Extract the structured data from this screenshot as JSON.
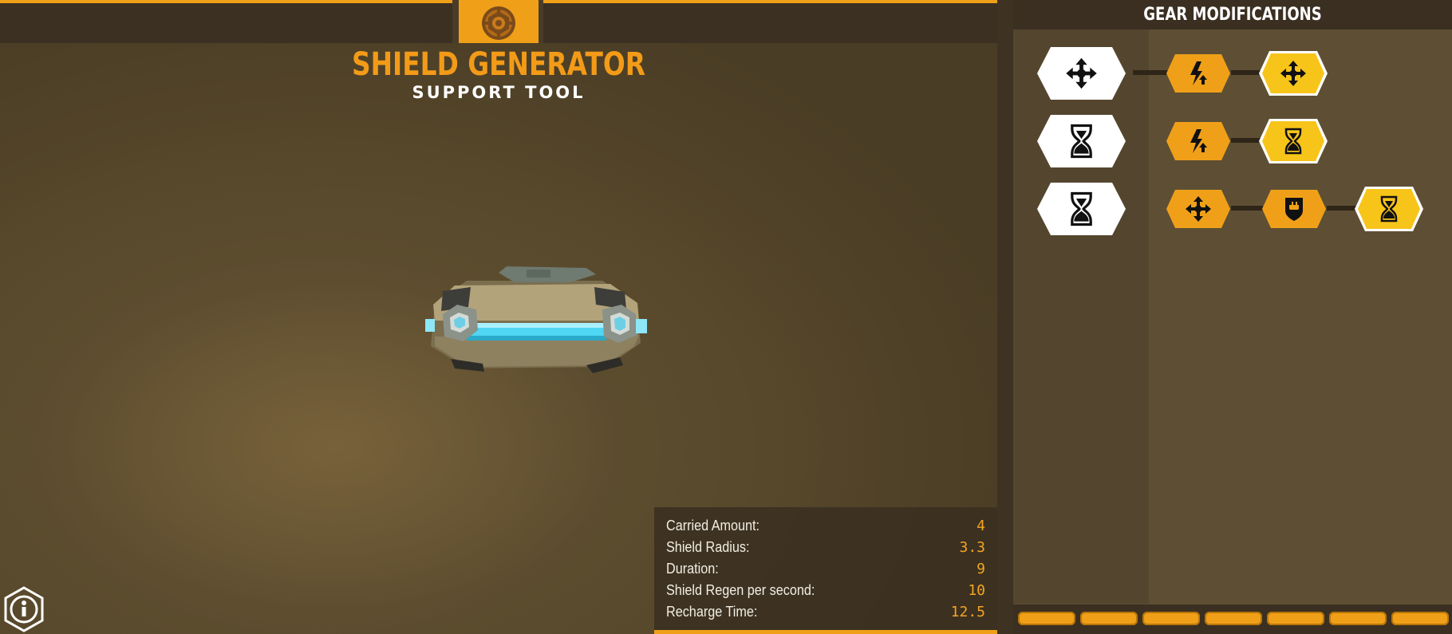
{
  "header": {
    "title": "SHIELD GENERATOR",
    "subtitle": "SUPPORT TOOL",
    "tool_icon": "shield-generator-icon"
  },
  "stats": [
    {
      "label": "Carried Amount:",
      "value": "4"
    },
    {
      "label": "Shield Radius:",
      "value": "3.3"
    },
    {
      "label": "Duration:",
      "value": "9"
    },
    {
      "label": "Shield Regen per second:",
      "value": "10"
    },
    {
      "label": "Recharge Time:",
      "value": "12.5"
    }
  ],
  "gear_panel": {
    "title": "GEAR MODIFICATIONS",
    "rows": [
      {
        "selected": "move-arrows-icon",
        "options": [
          "lightning-arrow-icon",
          "move-arrows-icon"
        ]
      },
      {
        "selected": "hourglass-icon",
        "options": [
          "lightning-arrow-icon",
          "hourglass-icon"
        ]
      },
      {
        "selected": "hourglass-icon",
        "options": [
          "move-arrows-icon",
          "shield-fist-icon",
          "hourglass-icon"
        ]
      }
    ],
    "footer_tabs": 7
  },
  "colors": {
    "accent": "#f0a018",
    "selected": "#f7c41a",
    "panel": "#5e4f34",
    "dark": "#3a2f21"
  },
  "info_icon": "info-icon"
}
